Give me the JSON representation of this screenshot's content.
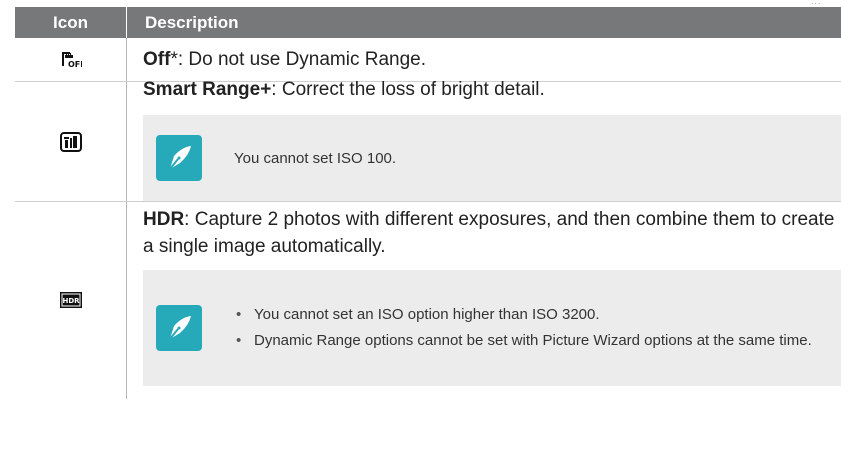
{
  "corner_text": "...",
  "table": {
    "headers": {
      "icon": "Icon",
      "description": "Description"
    },
    "rows": [
      {
        "icon_name": "dynamic-range-off-icon",
        "title": "Off",
        "title_suffix": "*",
        "text": ": Do not use Dynamic Range."
      },
      {
        "icon_name": "smart-range-plus-icon",
        "title": "Smart Range+",
        "text": ": Correct the loss of bright detail.",
        "note": "You cannot set ISO 100."
      },
      {
        "icon_name": "hdr-icon",
        "title": "HDR",
        "text": ": Capture 2 photos with different exposures, and then combine them to create a single image automatically.",
        "notes": [
          "You cannot set an ISO option higher than ISO 3200.",
          "Dynamic Range options cannot be set with Picture Wizard options at the same time."
        ]
      }
    ]
  },
  "colors": {
    "header_bg": "#77787a",
    "note_bg": "#ececec",
    "note_icon": "#26a9b9"
  }
}
